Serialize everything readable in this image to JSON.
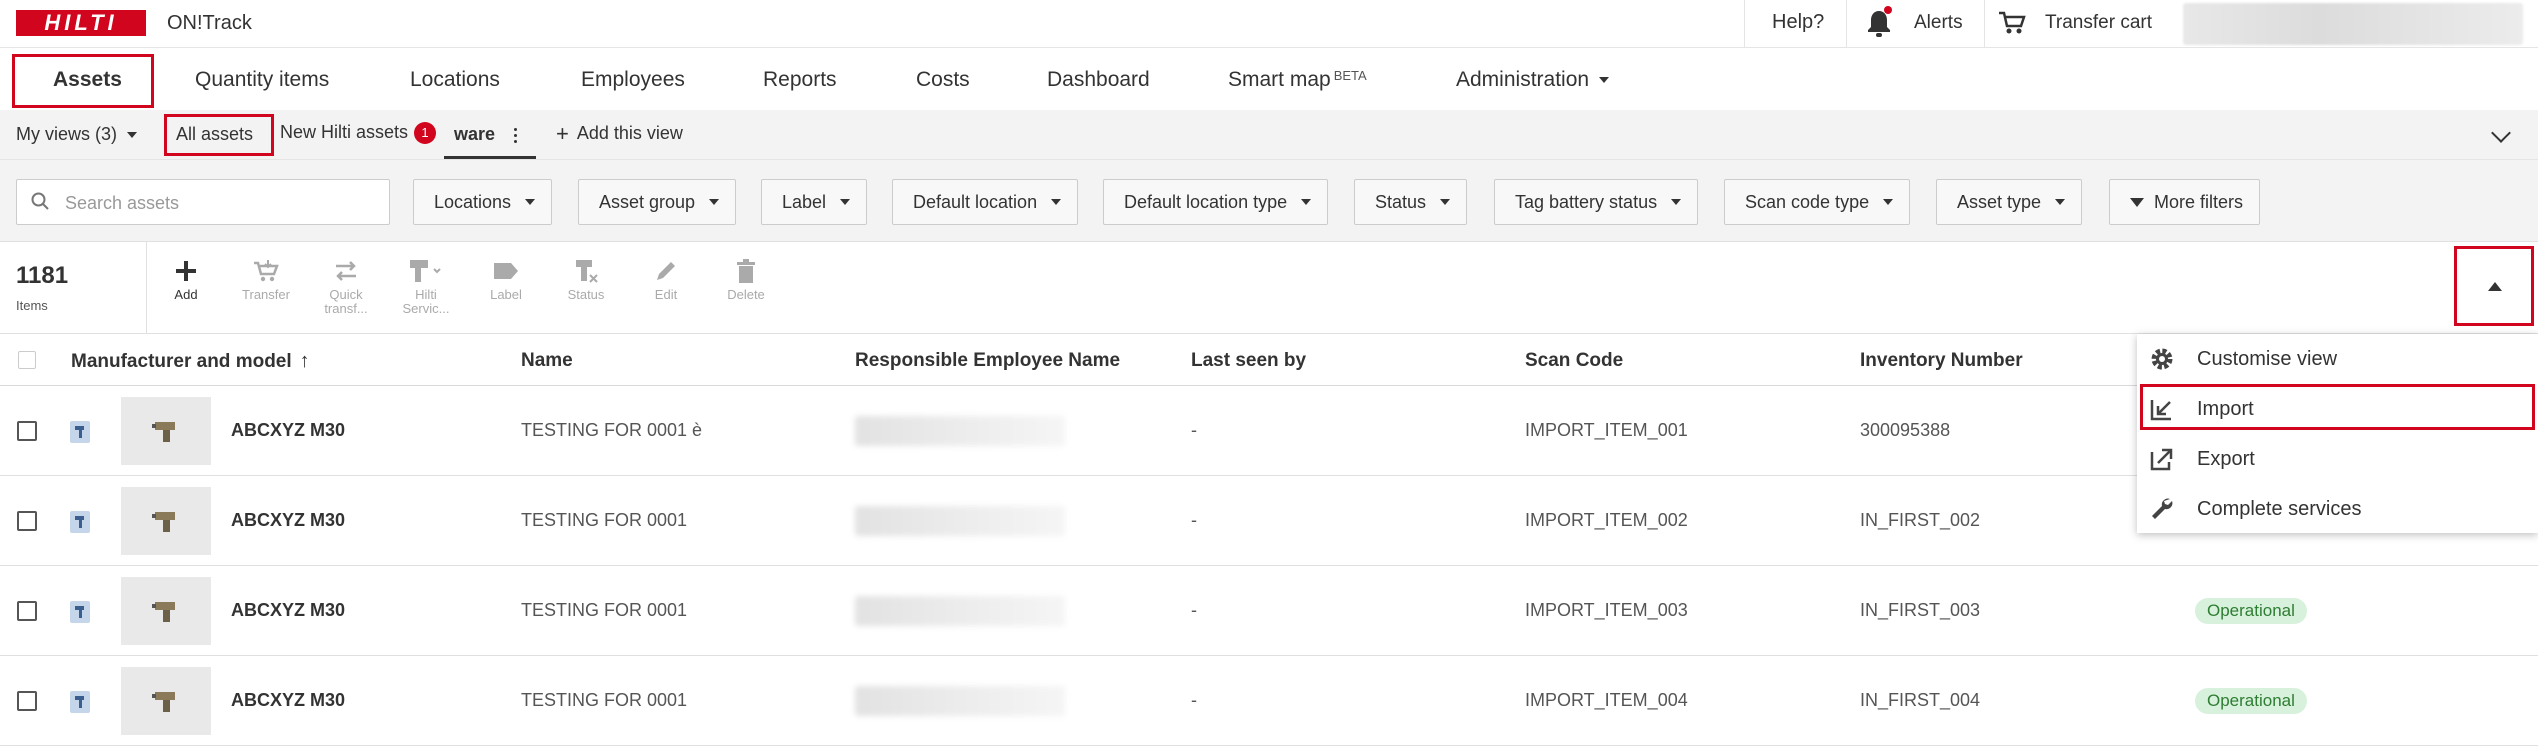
{
  "header": {
    "logo_text": "HILTI",
    "app_name": "ON!Track",
    "help_label": "Help?",
    "alerts_label": "Alerts",
    "transfer_cart_label": "Transfer cart",
    "brand_color": "#d2051e"
  },
  "nav": {
    "items": [
      {
        "label": "Assets",
        "active": true
      },
      {
        "label": "Quantity items"
      },
      {
        "label": "Locations"
      },
      {
        "label": "Employees"
      },
      {
        "label": "Reports"
      },
      {
        "label": "Costs"
      },
      {
        "label": "Dashboard"
      },
      {
        "label": "Smart map",
        "sup": "BETA"
      },
      {
        "label": "Administration"
      }
    ]
  },
  "views": {
    "my_views": "My views (3)",
    "all_assets": "All assets",
    "new_hilti_assets": "New Hilti assets",
    "new_badge": "1",
    "current_view": "ware",
    "add_view": "Add this view"
  },
  "filters": {
    "search_placeholder": "Search assets",
    "buttons": [
      "Locations",
      "Asset group",
      "Label",
      "Default location",
      "Default location type",
      "Status",
      "Tag battery status",
      "Scan code type",
      "Asset type"
    ],
    "more_filters": "More filters"
  },
  "toolbar": {
    "count": "1181",
    "count_label": "Items",
    "actions": [
      {
        "label": "Add",
        "icon": "plus-icon"
      },
      {
        "label": "Transfer",
        "icon": "transfer-icon"
      },
      {
        "label": "Quick transf...",
        "icon": "quick-transfer-icon"
      },
      {
        "label": "Hilti Servic...",
        "icon": "hilti-service-icon"
      },
      {
        "label": "Label",
        "icon": "label-icon"
      },
      {
        "label": "Status",
        "icon": "status-icon"
      },
      {
        "label": "Edit",
        "icon": "edit-icon"
      },
      {
        "label": "Delete",
        "icon": "delete-icon"
      }
    ]
  },
  "table": {
    "columns": [
      "Manufacturer and model",
      "Name",
      "Responsible Employee Name",
      "Last seen by",
      "Scan Code",
      "Inventory Number"
    ],
    "rows": [
      {
        "model": "ABCXYZ M30",
        "name": "TESTING FOR 0001 è",
        "last_seen": "-",
        "scan_code": "IMPORT_ITEM_001",
        "inventory": "300095388",
        "status": ""
      },
      {
        "model": "ABCXYZ M30",
        "name": "TESTING FOR 0001",
        "last_seen": "-",
        "scan_code": "IMPORT_ITEM_002",
        "inventory": "IN_FIRST_002",
        "status": ""
      },
      {
        "model": "ABCXYZ M30",
        "name": "TESTING FOR 0001",
        "last_seen": "-",
        "scan_code": "IMPORT_ITEM_003",
        "inventory": "IN_FIRST_003",
        "status": "Operational"
      },
      {
        "model": "ABCXYZ M30",
        "name": "TESTING FOR 0001",
        "last_seen": "-",
        "scan_code": "IMPORT_ITEM_004",
        "inventory": "IN_FIRST_004",
        "status": "Operational"
      }
    ]
  },
  "menu": {
    "items": [
      {
        "label": "Customise view",
        "icon": "gear-icon"
      },
      {
        "label": "Import",
        "icon": "import-icon"
      },
      {
        "label": "Export",
        "icon": "export-icon"
      },
      {
        "label": "Complete services",
        "icon": "wrench-icon"
      }
    ]
  }
}
